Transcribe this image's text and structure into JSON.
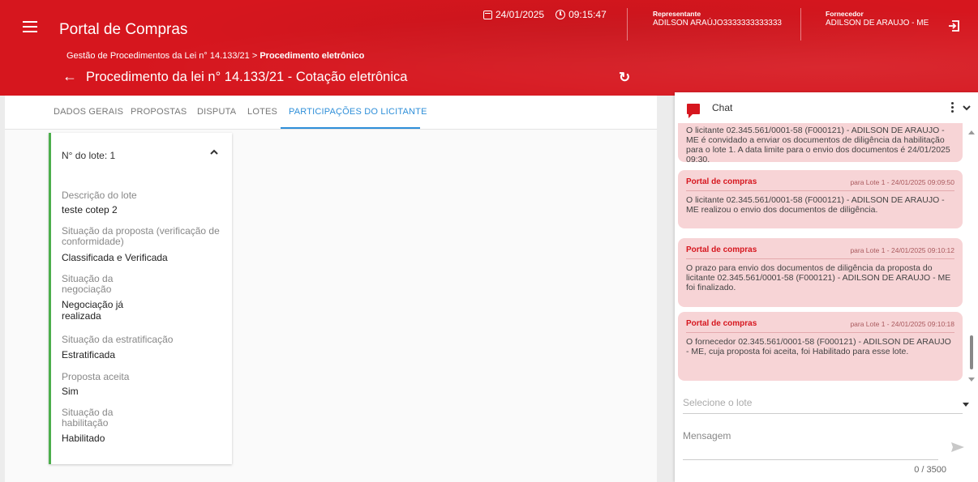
{
  "header": {
    "app_title": "Portal de Compras",
    "date": "24/01/2025",
    "time": "09:15:47",
    "representante_label": "Representante",
    "representante_value": "ADILSON ARAÚJO3333333333333",
    "fornecedor_label": "Fornecedor",
    "fornecedor_value": "ADILSON DE ARAUJO - ME",
    "breadcrumb_parent": "Gestão de Procedimentos da Lei n° 14.133/21 >",
    "breadcrumb_current": "Procedimento eletrônico",
    "page_title": "Procedimento da lei n° 14.133/21 - Cotação eletrônica",
    "brand_color": "#d6161e"
  },
  "tabs": [
    {
      "label": "DADOS GERAIS"
    },
    {
      "label": "PROPOSTAS"
    },
    {
      "label": "DISPUTA"
    },
    {
      "label": "LOTES"
    },
    {
      "label": "PARTICIPAÇÕES DO LICITANTE",
      "active": true
    }
  ],
  "lot": {
    "heading": "N° do lote: 1",
    "fields": [
      {
        "label": "Descrição do lote",
        "value": "teste cotep 2"
      },
      {
        "label_line1": "Situação da proposta (verificação de",
        "label_line2": "conformidade)",
        "value": "Classificada e Verificada"
      },
      {
        "label_line1": "Situação da",
        "label_line2": "negociação",
        "value_line1": "Negociação já",
        "value_line2": "realizada"
      },
      {
        "label": "Situação da estratificação",
        "value": "Estratificada"
      },
      {
        "label": "Proposta aceita",
        "value": "Sim"
      },
      {
        "label_line1": "Situação da",
        "label_line2": "habilitação",
        "value": "Habilitado"
      }
    ]
  },
  "chat": {
    "title": "Chat",
    "messages": [
      {
        "body": "O licitante 02.345.561/0001-58 (F000121) - ADILSON DE ARAUJO - ME é convidado a enviar os documentos de diligência da habilitação para o lote  1. A data limite para o envio dos documentos é 24/01/2025 09:30."
      },
      {
        "from": "Portal de compras",
        "meta": "para Lote 1  -  24/01/2025 09:09:50",
        "body": "O licitante 02.345.561/0001-58 (F000121) - ADILSON DE ARAUJO - ME realizou o envio dos documentos de diligência."
      },
      {
        "from": "Portal de compras",
        "meta": "para Lote 1  -  24/01/2025 09:10:12",
        "body": "O prazo para envio dos documentos de diligência da proposta do licitante 02.345.561/0001-58 (F000121) - ADILSON DE ARAUJO - ME foi finalizado."
      },
      {
        "from": "Portal de compras",
        "meta": "para Lote 1  -  24/01/2025 09:10:18",
        "body": "O fornecedor 02.345.561/0001-58 (F000121) - ADILSON DE ARAUJO - ME, cuja proposta foi aceita, foi Habilitado para esse lote."
      }
    ],
    "lot_select_placeholder": "Selecione o lote",
    "message_placeholder": "Mensagem",
    "counter": "0 / 3500"
  }
}
